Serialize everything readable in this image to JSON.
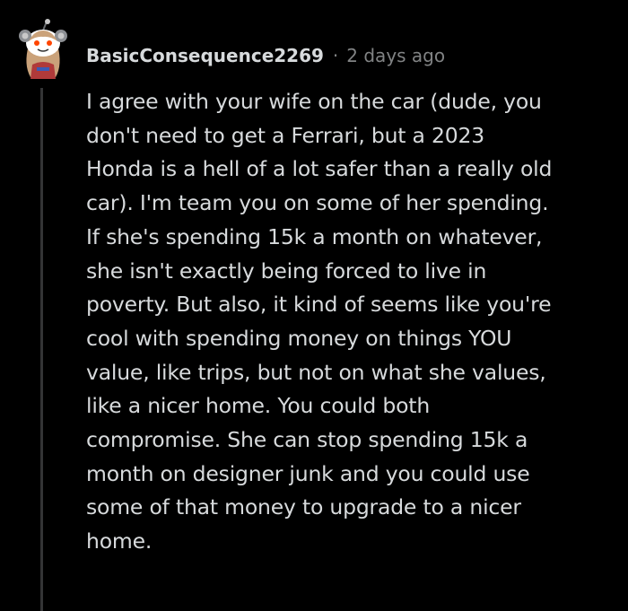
{
  "comment": {
    "author": "BasicConsequence2269",
    "separator": "·",
    "timestamp": "2 days ago",
    "avatar_icon": "snoo-avatar-icon",
    "body": "I agree with your wife on the car (dude, you\ndon't need to get a Ferrari, but a 2023\nHonda is a hell of a lot safer than a really old\ncar). I'm team you on some of her spending.\nIf she's spending 15k a month on whatever,\nshe isn't exactly being forced to live in\npoverty. But also, it kind of seems like you're\ncool with spending money on things YOU\nvalue, like trips, but not on what she values,\nlike a nicer home. You could both\ncompromise. She can stop spending 15k a\nmonth on designer junk and you could use\nsome of that money to upgrade to a nicer\nhome."
  },
  "colors": {
    "background": "#000000",
    "text": "#d7dadc",
    "meta": "#818384",
    "thread_line": "#343536"
  }
}
